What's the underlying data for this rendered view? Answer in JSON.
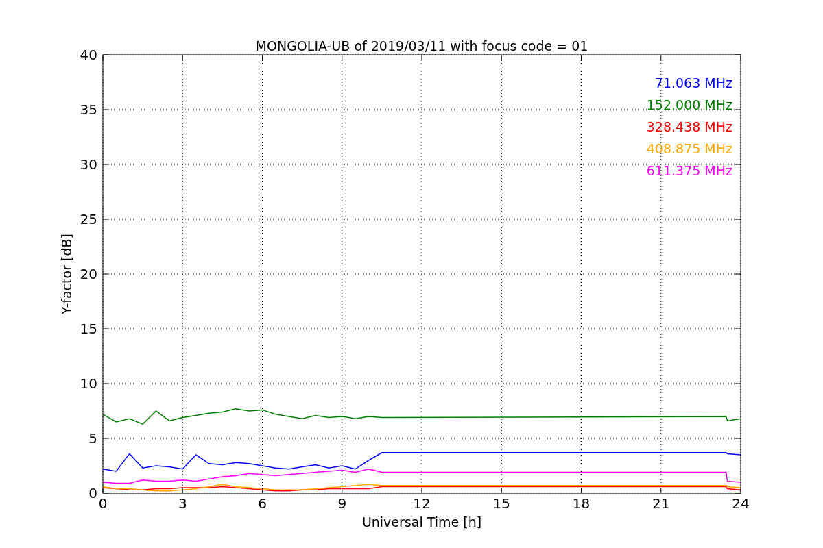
{
  "chart": {
    "chart_data": {
      "type": "line",
      "title": "MONGOLIA-UB of 2019/03/11 with focus code = 01",
      "xlabel": "Universal Time [h]",
      "ylabel": "Y-factor [dB]",
      "grid": true,
      "xlim": [
        0,
        24
      ],
      "ylim": [
        0,
        40
      ],
      "xticks": [
        0,
        3,
        6,
        9,
        12,
        15,
        18,
        21,
        24
      ],
      "yticks": [
        0,
        5,
        10,
        15,
        20,
        25,
        30,
        35,
        40
      ],
      "x": [
        0,
        0.5,
        1,
        1.5,
        2,
        2.5,
        3,
        3.5,
        4,
        4.5,
        5,
        5.5,
        6,
        6.5,
        7,
        7.5,
        8,
        8.5,
        9,
        9.5,
        10,
        10.5,
        23.45,
        23.5,
        24
      ],
      "series": [
        {
          "name": "71.063 MHz",
          "color": "#0000ff",
          "values": [
            2.2,
            2.0,
            3.6,
            2.3,
            2.5,
            2.4,
            2.2,
            3.5,
            2.7,
            2.6,
            2.8,
            2.7,
            2.5,
            2.3,
            2.2,
            2.4,
            2.6,
            2.3,
            2.5,
            2.2,
            3.0,
            3.7,
            3.7,
            3.6,
            3.5
          ]
        },
        {
          "name": "152.000 MHz",
          "color": "#008000",
          "values": [
            7.2,
            6.5,
            6.8,
            6.3,
            7.5,
            6.6,
            6.9,
            7.1,
            7.3,
            7.4,
            7.7,
            7.5,
            7.6,
            7.2,
            7.0,
            6.8,
            7.1,
            6.9,
            7.0,
            6.8,
            7.0,
            6.9,
            7.0,
            6.6,
            6.8
          ]
        },
        {
          "name": "328.438 MHz",
          "color": "#ff0000",
          "values": [
            0.5,
            0.4,
            0.3,
            0.3,
            0.4,
            0.4,
            0.5,
            0.5,
            0.5,
            0.6,
            0.5,
            0.4,
            0.3,
            0.2,
            0.2,
            0.3,
            0.3,
            0.4,
            0.4,
            0.4,
            0.4,
            0.6,
            0.6,
            0.4,
            0.3
          ]
        },
        {
          "name": "408.875 MHz",
          "color": "#ffa500",
          "values": [
            0.6,
            0.4,
            0.4,
            0.3,
            0.2,
            0.2,
            0.3,
            0.4,
            0.6,
            0.8,
            0.6,
            0.5,
            0.4,
            0.3,
            0.3,
            0.3,
            0.4,
            0.5,
            0.6,
            0.7,
            0.8,
            0.7,
            0.7,
            0.6,
            0.5
          ]
        },
        {
          "name": "611.375 MHz",
          "color": "#ff00ff",
          "values": [
            1.0,
            0.9,
            0.9,
            1.2,
            1.1,
            1.1,
            1.2,
            1.1,
            1.3,
            1.5,
            1.6,
            1.8,
            1.7,
            1.6,
            1.7,
            1.8,
            1.9,
            2.0,
            2.1,
            1.9,
            2.2,
            1.9,
            1.9,
            1.1,
            1.0
          ]
        }
      ]
    }
  }
}
